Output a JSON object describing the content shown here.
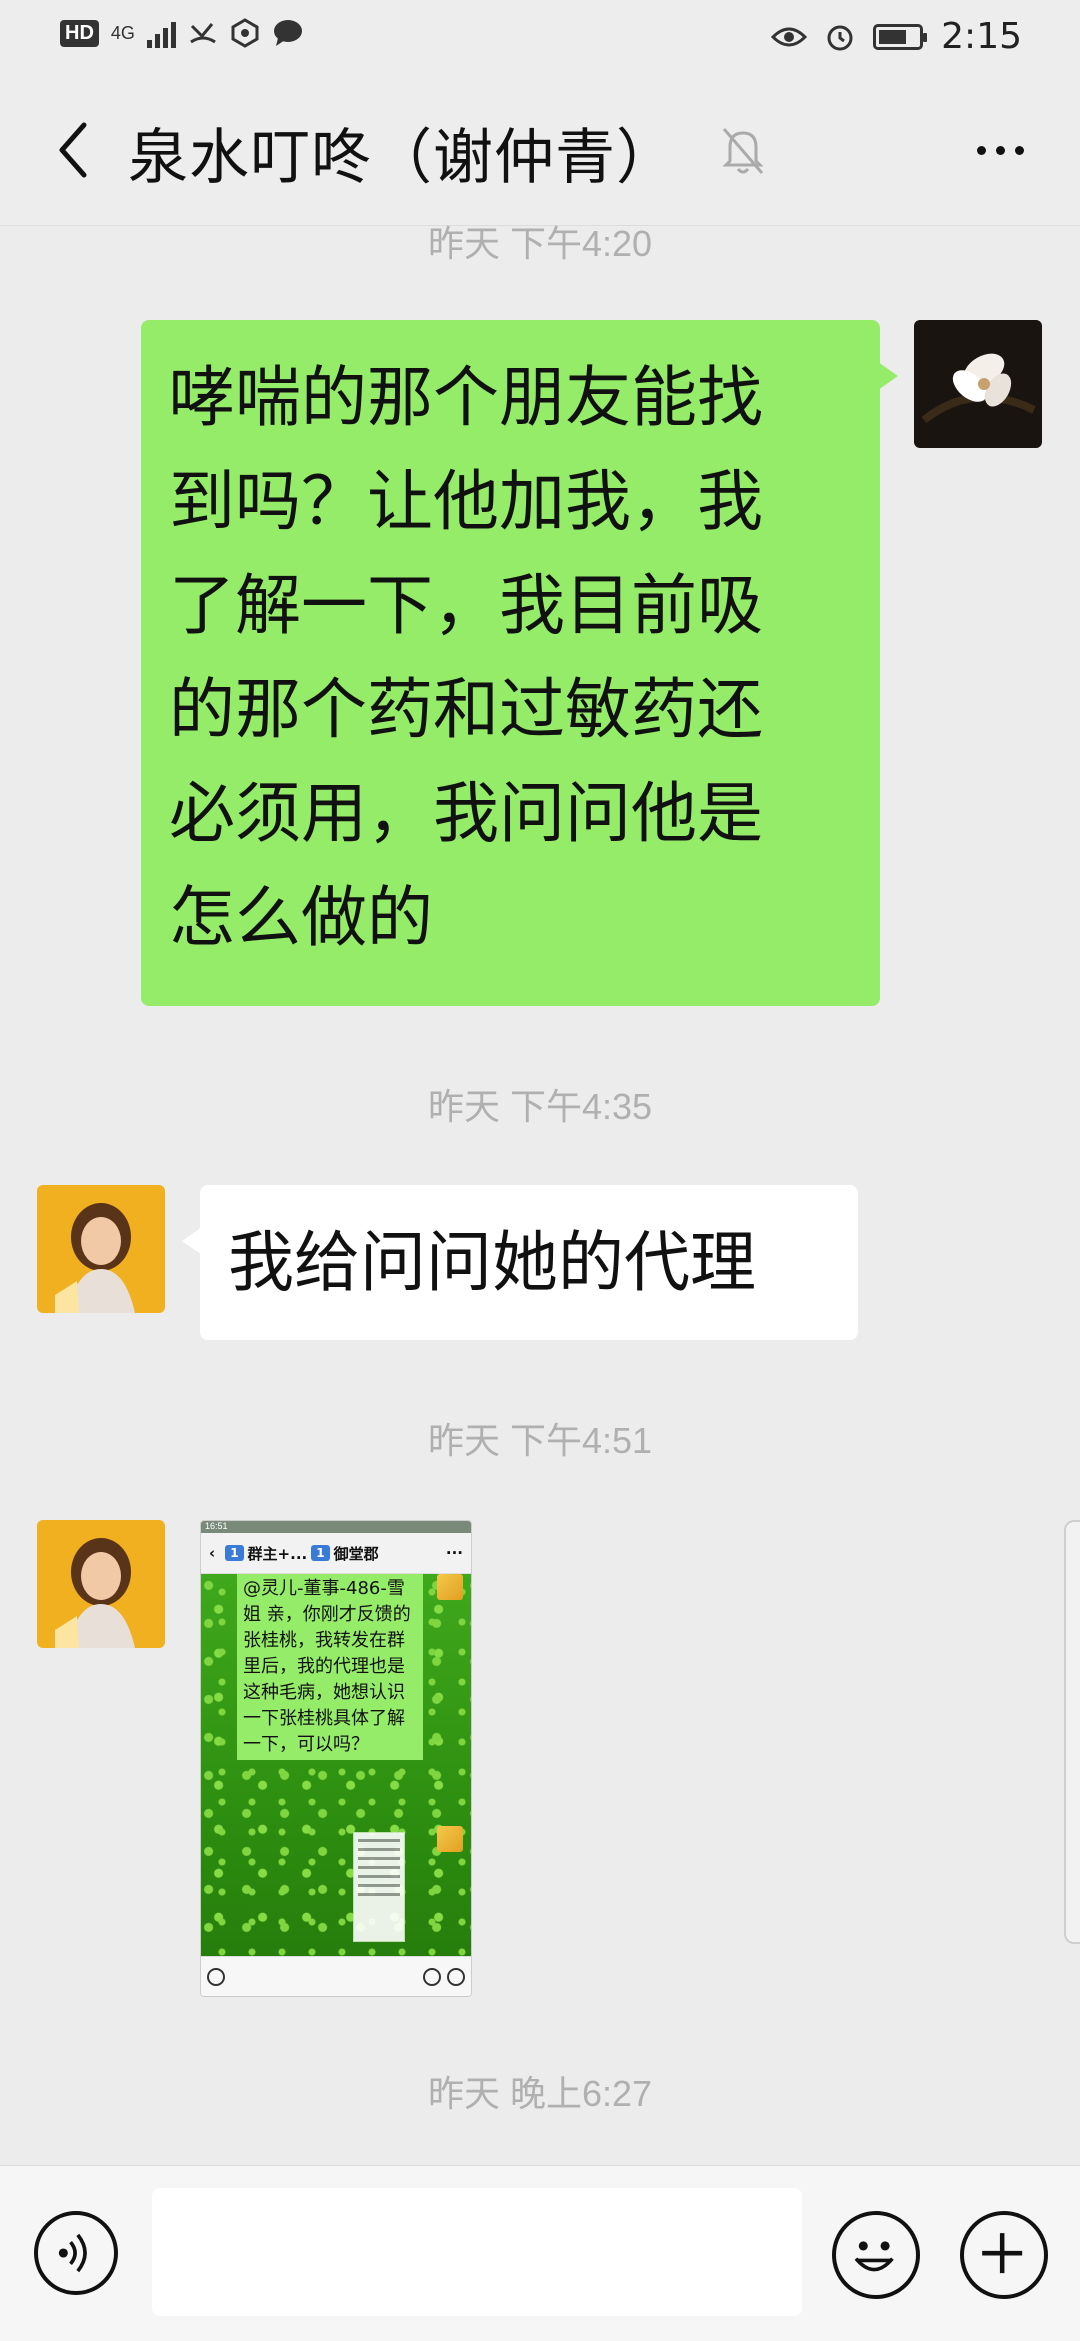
{
  "status_bar": {
    "hd": "HD",
    "network": "4G",
    "time": "2:15"
  },
  "header": {
    "title": "泉水叮咚（谢仲青）",
    "icons": [
      "back-icon",
      "mute-bell-icon",
      "more-icon"
    ]
  },
  "messages": [
    {
      "type": "timestamp",
      "text": "昨天 下午4:20"
    },
    {
      "type": "text",
      "side": "right",
      "lines": [
        "哮喘的那个朋友能找",
        "到吗？让他加我，我",
        "了解一下，我目前吸",
        "的那个药和过敏药还",
        "必须用，我问问他是",
        "怎么做的"
      ]
    },
    {
      "type": "timestamp",
      "text": "昨天 下午4:35"
    },
    {
      "type": "text",
      "side": "left",
      "text": "我给问问她的代理"
    },
    {
      "type": "timestamp",
      "text": "昨天 下午4:51"
    },
    {
      "type": "image",
      "side": "left",
      "screenshot": {
        "status_time": "16:51",
        "header_chat1": "群主+...",
        "header_badge": "1",
        "header_chat2": "御堂郡",
        "message": "@灵儿-董事-486-雪姐 亲，你刚才反馈的张桂桃，我转发在群里后，我的代理也是这种毛病，她想认识一下张桂桃具体了解一下，可以吗？"
      }
    },
    {
      "type": "timestamp",
      "text": "昨天 晚上6:27"
    }
  ],
  "input_bar": {
    "placeholder": "",
    "icons": [
      "voice-icon",
      "emoji-icon",
      "plus-icon"
    ]
  }
}
